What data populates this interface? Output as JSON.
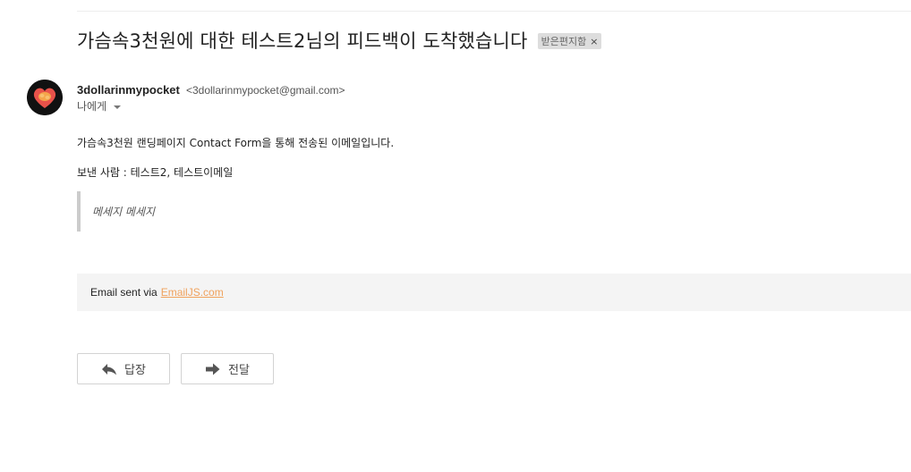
{
  "email": {
    "subject": "가슴속3천원에 대한 테스트2님의 피드백이 도착했습니다",
    "label": "받은편지함",
    "label_remove": "×",
    "sender_name": "3dollarinmypocket",
    "sender_email": "<3dollarinmypocket@gmail.com>",
    "to": "나에게",
    "body_line1": "가슴속3천원 랜딩페이지 Contact Form을 통해 전송된 이메일입니다.",
    "body_line2": "보낸 사람 : 테스트2, 테스트이메일",
    "quote": "메세지 메세지",
    "footer_prefix": "Email sent via",
    "footer_link": "EmailJS.com"
  },
  "actions": {
    "reply_label": "답장",
    "forward_label": "전달",
    "reply_icon": "reply-icon",
    "forward_icon": "forward-icon"
  },
  "colors": {
    "link": "#f0a25c",
    "avatar_bg": "#111111",
    "avatar_heart": "#e8524a",
    "avatar_bun": "#f5a54a"
  }
}
